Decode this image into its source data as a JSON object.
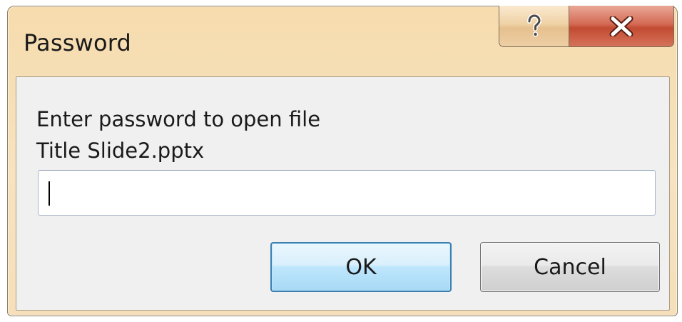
{
  "window": {
    "title": "Password",
    "help_icon": "question-mark-icon",
    "close_icon": "close-x-icon"
  },
  "dialog": {
    "prompt": "Enter password to open file",
    "file_name": "Title Slide2.pptx",
    "password_value": "",
    "ok_label": "OK",
    "cancel_label": "Cancel"
  },
  "colors": {
    "frame": "#f7dfb6",
    "client": "#f0f0f0",
    "close_button": "#c9553c",
    "default_button_border": "#3c7fb1"
  }
}
